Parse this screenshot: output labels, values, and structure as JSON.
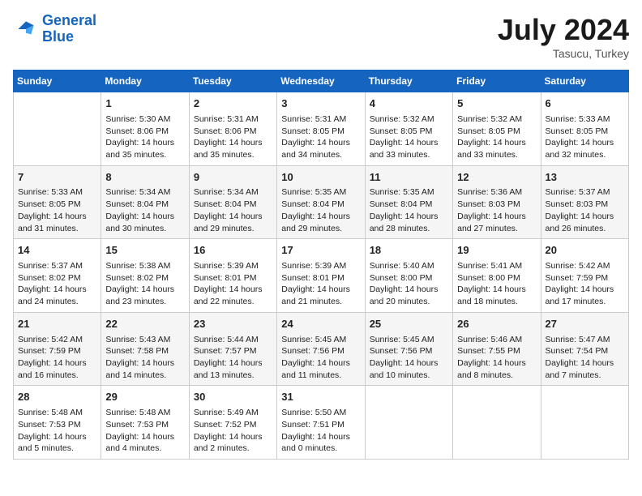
{
  "header": {
    "logo_line1": "General",
    "logo_line2": "Blue",
    "month_year": "July 2024",
    "location": "Tasucu, Turkey"
  },
  "weekdays": [
    "Sunday",
    "Monday",
    "Tuesday",
    "Wednesday",
    "Thursday",
    "Friday",
    "Saturday"
  ],
  "weeks": [
    [
      {
        "day": "",
        "info": ""
      },
      {
        "day": "1",
        "info": "Sunrise: 5:30 AM\nSunset: 8:06 PM\nDaylight: 14 hours\nand 35 minutes."
      },
      {
        "day": "2",
        "info": "Sunrise: 5:31 AM\nSunset: 8:06 PM\nDaylight: 14 hours\nand 35 minutes."
      },
      {
        "day": "3",
        "info": "Sunrise: 5:31 AM\nSunset: 8:05 PM\nDaylight: 14 hours\nand 34 minutes."
      },
      {
        "day": "4",
        "info": "Sunrise: 5:32 AM\nSunset: 8:05 PM\nDaylight: 14 hours\nand 33 minutes."
      },
      {
        "day": "5",
        "info": "Sunrise: 5:32 AM\nSunset: 8:05 PM\nDaylight: 14 hours\nand 33 minutes."
      },
      {
        "day": "6",
        "info": "Sunrise: 5:33 AM\nSunset: 8:05 PM\nDaylight: 14 hours\nand 32 minutes."
      }
    ],
    [
      {
        "day": "7",
        "info": "Sunrise: 5:33 AM\nSunset: 8:05 PM\nDaylight: 14 hours\nand 31 minutes."
      },
      {
        "day": "8",
        "info": "Sunrise: 5:34 AM\nSunset: 8:04 PM\nDaylight: 14 hours\nand 30 minutes."
      },
      {
        "day": "9",
        "info": "Sunrise: 5:34 AM\nSunset: 8:04 PM\nDaylight: 14 hours\nand 29 minutes."
      },
      {
        "day": "10",
        "info": "Sunrise: 5:35 AM\nSunset: 8:04 PM\nDaylight: 14 hours\nand 29 minutes."
      },
      {
        "day": "11",
        "info": "Sunrise: 5:35 AM\nSunset: 8:04 PM\nDaylight: 14 hours\nand 28 minutes."
      },
      {
        "day": "12",
        "info": "Sunrise: 5:36 AM\nSunset: 8:03 PM\nDaylight: 14 hours\nand 27 minutes."
      },
      {
        "day": "13",
        "info": "Sunrise: 5:37 AM\nSunset: 8:03 PM\nDaylight: 14 hours\nand 26 minutes."
      }
    ],
    [
      {
        "day": "14",
        "info": "Sunrise: 5:37 AM\nSunset: 8:02 PM\nDaylight: 14 hours\nand 24 minutes."
      },
      {
        "day": "15",
        "info": "Sunrise: 5:38 AM\nSunset: 8:02 PM\nDaylight: 14 hours\nand 23 minutes."
      },
      {
        "day": "16",
        "info": "Sunrise: 5:39 AM\nSunset: 8:01 PM\nDaylight: 14 hours\nand 22 minutes."
      },
      {
        "day": "17",
        "info": "Sunrise: 5:39 AM\nSunset: 8:01 PM\nDaylight: 14 hours\nand 21 minutes."
      },
      {
        "day": "18",
        "info": "Sunrise: 5:40 AM\nSunset: 8:00 PM\nDaylight: 14 hours\nand 20 minutes."
      },
      {
        "day": "19",
        "info": "Sunrise: 5:41 AM\nSunset: 8:00 PM\nDaylight: 14 hours\nand 18 minutes."
      },
      {
        "day": "20",
        "info": "Sunrise: 5:42 AM\nSunset: 7:59 PM\nDaylight: 14 hours\nand 17 minutes."
      }
    ],
    [
      {
        "day": "21",
        "info": "Sunrise: 5:42 AM\nSunset: 7:59 PM\nDaylight: 14 hours\nand 16 minutes."
      },
      {
        "day": "22",
        "info": "Sunrise: 5:43 AM\nSunset: 7:58 PM\nDaylight: 14 hours\nand 14 minutes."
      },
      {
        "day": "23",
        "info": "Sunrise: 5:44 AM\nSunset: 7:57 PM\nDaylight: 14 hours\nand 13 minutes."
      },
      {
        "day": "24",
        "info": "Sunrise: 5:45 AM\nSunset: 7:56 PM\nDaylight: 14 hours\nand 11 minutes."
      },
      {
        "day": "25",
        "info": "Sunrise: 5:45 AM\nSunset: 7:56 PM\nDaylight: 14 hours\nand 10 minutes."
      },
      {
        "day": "26",
        "info": "Sunrise: 5:46 AM\nSunset: 7:55 PM\nDaylight: 14 hours\nand 8 minutes."
      },
      {
        "day": "27",
        "info": "Sunrise: 5:47 AM\nSunset: 7:54 PM\nDaylight: 14 hours\nand 7 minutes."
      }
    ],
    [
      {
        "day": "28",
        "info": "Sunrise: 5:48 AM\nSunset: 7:53 PM\nDaylight: 14 hours\nand 5 minutes."
      },
      {
        "day": "29",
        "info": "Sunrise: 5:48 AM\nSunset: 7:53 PM\nDaylight: 14 hours\nand 4 minutes."
      },
      {
        "day": "30",
        "info": "Sunrise: 5:49 AM\nSunset: 7:52 PM\nDaylight: 14 hours\nand 2 minutes."
      },
      {
        "day": "31",
        "info": "Sunrise: 5:50 AM\nSunset: 7:51 PM\nDaylight: 14 hours\nand 0 minutes."
      },
      {
        "day": "",
        "info": ""
      },
      {
        "day": "",
        "info": ""
      },
      {
        "day": "",
        "info": ""
      }
    ]
  ]
}
